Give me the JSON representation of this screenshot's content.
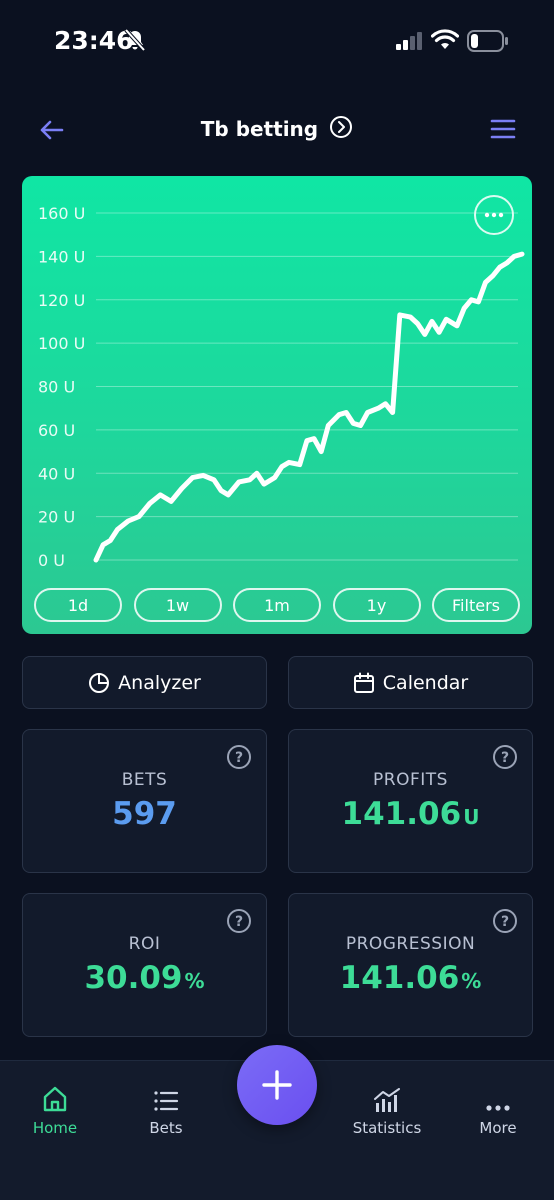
{
  "status": {
    "time": "23:46"
  },
  "header": {
    "title": "Tb betting"
  },
  "chart_data": {
    "type": "line",
    "y_tick_labels": [
      "160 U",
      "140 U",
      "120 U",
      "100 U",
      "80 U",
      "60 U",
      "40 U",
      "20 U",
      "0 U"
    ],
    "y_ticks": [
      160,
      140,
      120,
      100,
      80,
      60,
      40,
      20,
      0
    ],
    "ylim": [
      0,
      165
    ],
    "xlim": [
      0,
      596
    ],
    "series": [
      {
        "values": [
          [
            0,
            0
          ],
          [
            10,
            7
          ],
          [
            20,
            9
          ],
          [
            30,
            14
          ],
          [
            45,
            18
          ],
          [
            60,
            20
          ],
          [
            75,
            26
          ],
          [
            90,
            30
          ],
          [
            105,
            27
          ],
          [
            120,
            33
          ],
          [
            135,
            38
          ],
          [
            150,
            39
          ],
          [
            165,
            37
          ],
          [
            175,
            32
          ],
          [
            185,
            30
          ],
          [
            200,
            36
          ],
          [
            215,
            37
          ],
          [
            225,
            40
          ],
          [
            235,
            35
          ],
          [
            250,
            38
          ],
          [
            260,
            43
          ],
          [
            270,
            45
          ],
          [
            285,
            44
          ],
          [
            295,
            55
          ],
          [
            305,
            56
          ],
          [
            315,
            50
          ],
          [
            325,
            62
          ],
          [
            340,
            67
          ],
          [
            350,
            68
          ],
          [
            360,
            63
          ],
          [
            370,
            62
          ],
          [
            380,
            68
          ],
          [
            395,
            70
          ],
          [
            405,
            72
          ],
          [
            415,
            68
          ],
          [
            425,
            113
          ],
          [
            440,
            112
          ],
          [
            450,
            109
          ],
          [
            460,
            104
          ],
          [
            470,
            110
          ],
          [
            480,
            105
          ],
          [
            490,
            111
          ],
          [
            505,
            108
          ],
          [
            515,
            116
          ],
          [
            525,
            120
          ],
          [
            535,
            119
          ],
          [
            545,
            128
          ],
          [
            555,
            131
          ],
          [
            565,
            135
          ],
          [
            575,
            137
          ],
          [
            585,
            140
          ],
          [
            596,
            141.06
          ]
        ]
      }
    ],
    "line_color": "#ffffff",
    "grid": true
  },
  "ranges": [
    "1d",
    "1w",
    "1m",
    "1y",
    "Filters"
  ],
  "actions": {
    "analyzer": "Analyzer",
    "calendar": "Calendar"
  },
  "stats": {
    "bets": {
      "label": "BETS",
      "value": "597",
      "unit": "",
      "color": "#5b9cf0"
    },
    "profits": {
      "label": "PROFITS",
      "value": "141.06",
      "unit": "U",
      "color": "#3ddc97"
    },
    "roi": {
      "label": "ROI",
      "value": "30.09",
      "unit": "%",
      "color": "#3ddc97"
    },
    "progression": {
      "label": "PROGRESSION",
      "value": "141.06",
      "unit": "%",
      "color": "#3ddc97"
    }
  },
  "nav": {
    "home": "Home",
    "bets": "Bets",
    "statistics": "Statistics",
    "more": "More",
    "active_color": "#3ddc97"
  }
}
